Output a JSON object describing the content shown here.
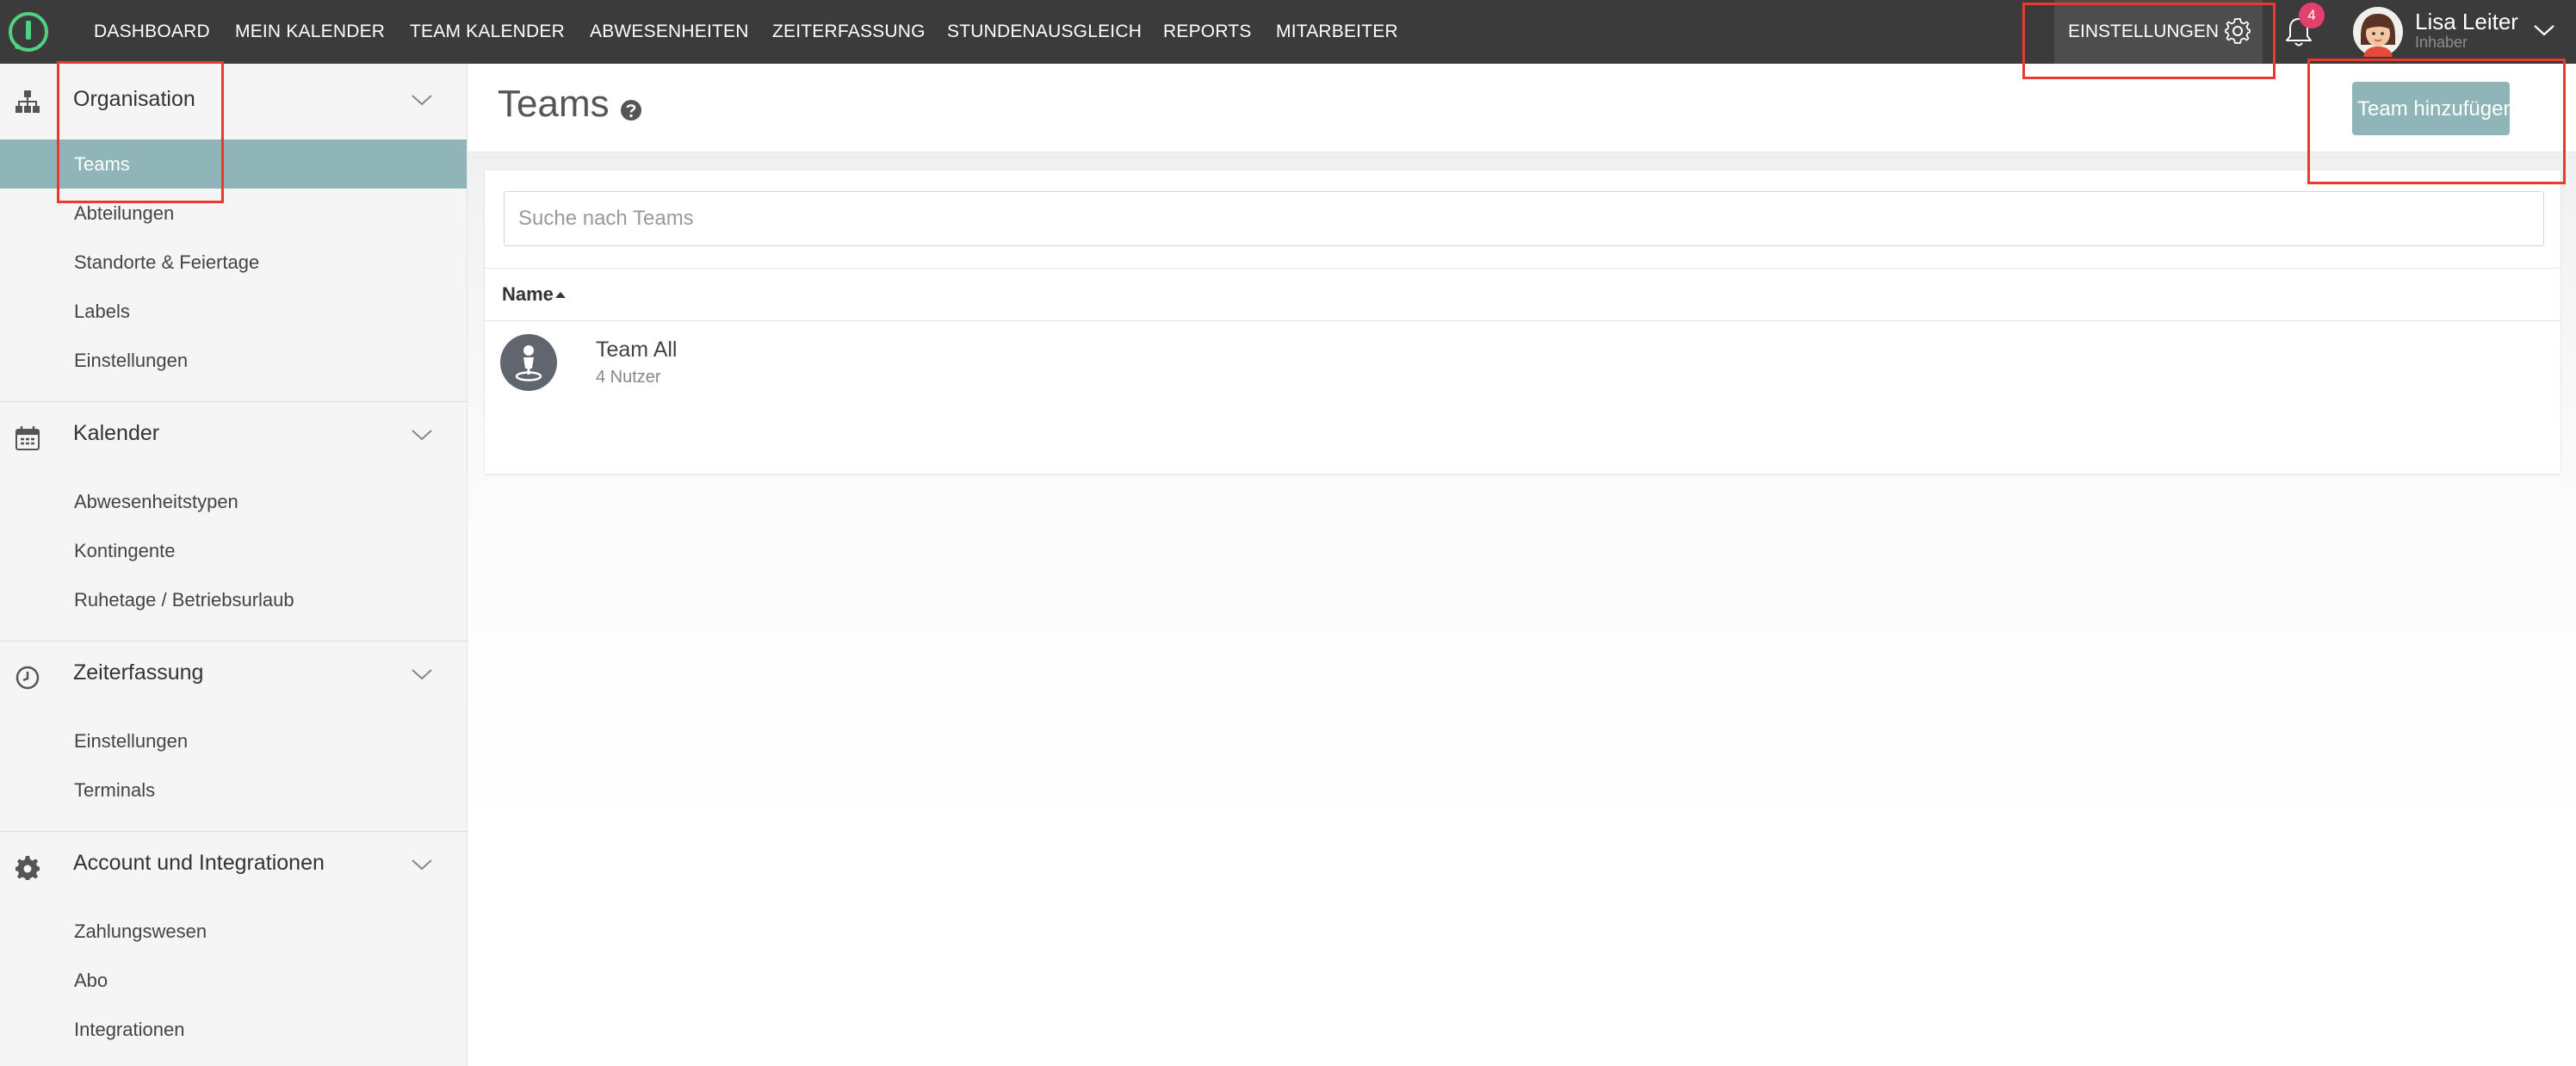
{
  "topnav": {
    "items": [
      "DASHBOARD",
      "MEIN KALENDER",
      "TEAM KALENDER",
      "ABWESENHEITEN",
      "ZEITERFASSUNG",
      "STUNDENAUSGLEICH",
      "REPORTS",
      "MITARBEITER"
    ],
    "settings_label": "EINSTELLUNGEN",
    "notification_count": "4",
    "user": {
      "name": "Lisa Leiter",
      "role": "Inhaber"
    },
    "icons": {
      "logo": "app-logo",
      "settings": "gear-icon",
      "notifications": "bell-icon",
      "user_menu": "chevron-down-icon"
    }
  },
  "sidebar": {
    "sections": [
      {
        "title": "Organisation",
        "icon": "sitemap-icon",
        "items": [
          "Teams",
          "Abteilungen",
          "Standorte & Feiertage",
          "Labels",
          "Einstellungen"
        ]
      },
      {
        "title": "Kalender",
        "icon": "calendar-icon",
        "items": [
          "Abwesenheitstypen",
          "Kontingente",
          "Ruhetage / Betriebsurlaub"
        ]
      },
      {
        "title": "Zeiterfassung",
        "icon": "clock-icon",
        "items": [
          "Einstellungen",
          "Terminals"
        ]
      },
      {
        "title": "Account und Integrationen",
        "icon": "cog-icon",
        "items": [
          "Zahlungswesen",
          "Abo",
          "Integrationen"
        ]
      }
    ],
    "active_item": "Teams"
  },
  "main": {
    "title": "Teams",
    "add_button": "Team hinzufügen",
    "search_placeholder": "Suche nach Teams",
    "search_value": "",
    "table": {
      "column": "Name",
      "sort": "ascending",
      "rows": [
        {
          "name": "Team All",
          "users": "4 Nutzer"
        }
      ]
    }
  },
  "colors": {
    "topbar": "#3b3b3b",
    "accent": "#8fb5b8",
    "badge": "#e3406b",
    "highlight": "#e63b2e"
  }
}
